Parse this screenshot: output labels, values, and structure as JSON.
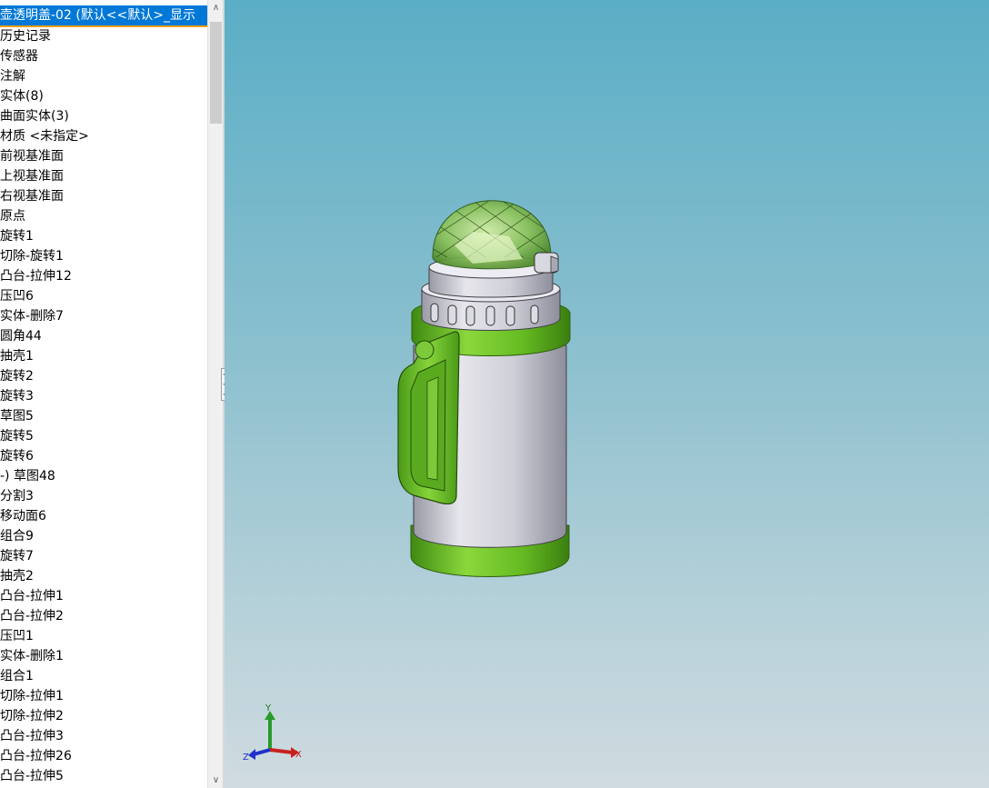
{
  "tree": {
    "header": "壶透明盖-02  (默认<<默认>_显示",
    "items": [
      "历史记录",
      "传感器",
      "注解",
      "实体(8)",
      "曲面实体(3)",
      "材质 <未指定>",
      "前视基准面",
      "上视基准面",
      "右视基准面",
      "原点",
      "旋转1",
      "切除-旋转1",
      "凸台-拉伸12",
      "压凹6",
      "实体-删除7",
      "圆角44",
      "抽壳1",
      "旋转2",
      "旋转3",
      "草图5",
      "旋转5",
      "旋转6",
      "-) 草图48",
      "分割3",
      "移动面6",
      "组合9",
      "旋转7",
      "抽壳2",
      "凸台-拉伸1",
      "凸台-拉伸2",
      "压凹1",
      "实体-删除1",
      "组合1",
      "切除-拉伸1",
      "切除-拉伸2",
      "凸台-拉伸3",
      "凸台-拉伸26",
      "凸台-拉伸5"
    ]
  },
  "scrollbar": {
    "up_icon": "chevron-up-icon",
    "down_icon": "chevron-down-icon"
  },
  "triad": {
    "x_label": "X",
    "y_label": "Y",
    "z_label": "Z"
  },
  "colors": {
    "body_green": "#6cc024",
    "body_silver": "#c8c8d0",
    "selection_blue": "#0078d7"
  }
}
